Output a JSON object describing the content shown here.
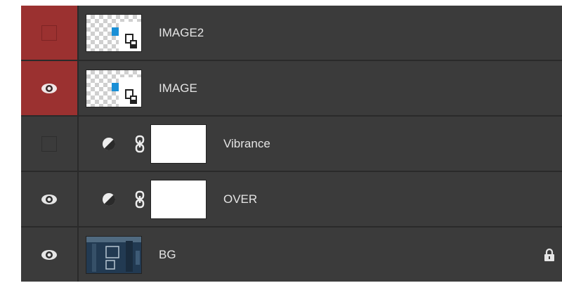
{
  "panel": {
    "colors": {
      "row_bg": "#3b3b3b",
      "selected_vis_bg": "#9b3130",
      "text": "#e4e4e4",
      "accent_blue": "#1a8fd6"
    },
    "layers": [
      {
        "name": "IMAGE2",
        "visible": false,
        "highlighted": true,
        "type": "smart-object"
      },
      {
        "name": "IMAGE",
        "visible": true,
        "highlighted": true,
        "type": "smart-object"
      },
      {
        "name": "Vibrance",
        "visible": false,
        "highlighted": false,
        "type": "adjustment"
      },
      {
        "name": "OVER",
        "visible": true,
        "highlighted": false,
        "type": "adjustment"
      },
      {
        "name": "BG",
        "visible": true,
        "highlighted": false,
        "type": "background",
        "locked": true
      }
    ]
  }
}
